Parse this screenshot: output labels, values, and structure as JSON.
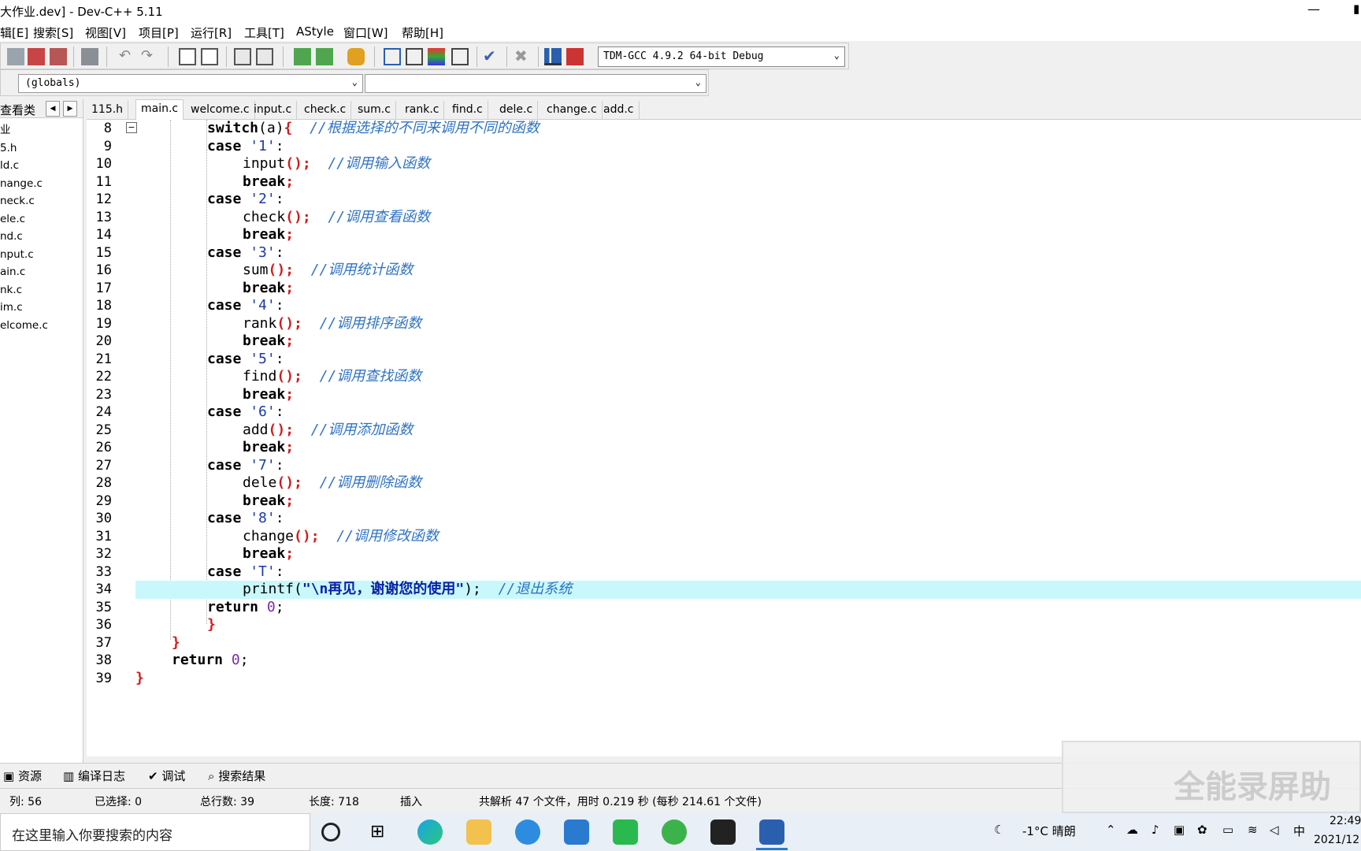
{
  "window": {
    "title": "大作业.dev] - Dev-C++ 5.11",
    "minimize": "—",
    "maximize": "▢"
  },
  "menu": [
    "编辑[E]",
    "搜索[S]",
    "视图[V]",
    "项目[P]",
    "运行[R]",
    "工具[T]",
    "AStyle",
    "窗口[W]",
    "帮助[H]"
  ],
  "menu_visible_first": "辑[E]",
  "compiler": "TDM-GCC 4.9.2 64-bit Debug",
  "globals_combo": "(globals)",
  "left_panel": {
    "header": "查看类",
    "project": "业",
    "files": [
      "5.h",
      "ld.c",
      "nange.c",
      "neck.c",
      "ele.c",
      "nd.c",
      "nput.c",
      "ain.c",
      "nk.c",
      "im.c",
      "elcome.c"
    ]
  },
  "tabs": [
    "115.h",
    "main.c",
    "welcome.c",
    "input.c",
    "check.c",
    "sum.c",
    "rank.c",
    "find.c",
    "dele.c",
    "change.c",
    "add.c"
  ],
  "active_tab": "main.c",
  "code": {
    "c8": "//根据选择的不同来调用不同的函数",
    "c10": "//调用输入函数",
    "c13": "//调用查看函数",
    "c16": "//调用统计函数",
    "c19": "//调用排序函数",
    "c22": "//调用查找函数",
    "c25": "//调用添加函数",
    "c28": "//调用删除函数",
    "c31": "//调用修改函数",
    "c34": "//退出系统",
    "s34": "\"\\n再见，谢谢您的使用\""
  },
  "bottom_tabs": [
    "资源",
    "编译日志",
    "调试",
    "搜索结果"
  ],
  "status": {
    "col_label": "列:",
    "col": "56",
    "sel_label": "已选择:",
    "sel": "0",
    "lines_label": "总行数:",
    "lines": "39",
    "len_label": "长度:",
    "len": "718",
    "mode": "插入",
    "message": "共解析 47 个文件，用时 0.219 秒 (每秒 214.61 个文件)"
  },
  "taskbar": {
    "search_placeholder": "在这里输入你要搜索的内容",
    "weather": "-1°C  晴朗",
    "ime": "中",
    "time": "22:49",
    "date": "2021/12"
  },
  "watermark": "全能录屏助"
}
